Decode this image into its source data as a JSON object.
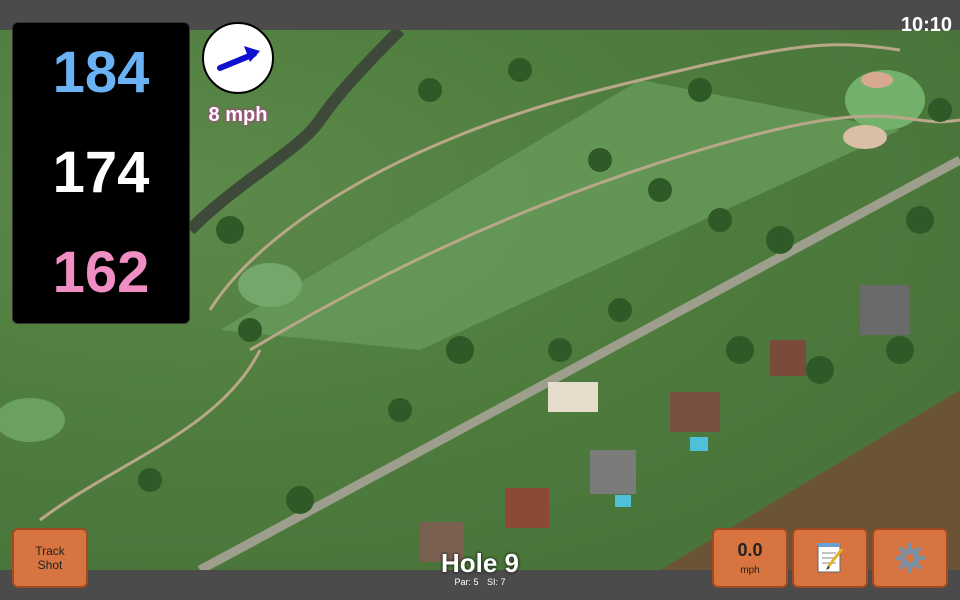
{
  "status": {
    "time": "10:10"
  },
  "distances": {
    "back": "184",
    "middle": "174",
    "front": "162"
  },
  "wind": {
    "speed_label": "8 mph",
    "icon": "wind-arrow-icon"
  },
  "hole": {
    "title": "Hole 9",
    "par_label": "Par: 5",
    "si_label": "SI: 7"
  },
  "buttons": {
    "track_shot_line1": "Track",
    "track_shot_line2": "Shot",
    "speed_value": "0.0",
    "speed_unit": "mph",
    "notes_icon": "notepad-icon",
    "settings_icon": "gear-icon"
  },
  "colors": {
    "back": "#6bb2f5",
    "middle": "#ffffff",
    "front": "#f08ec4",
    "button": "#d8743f",
    "wind_arrow": "#1010d0"
  }
}
